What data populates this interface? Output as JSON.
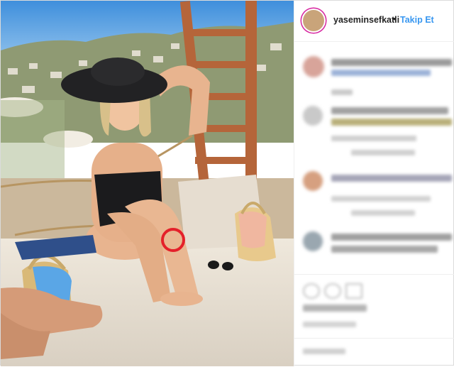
{
  "post": {
    "username": "yaseminsefkatli",
    "separator": "•",
    "follow_label": "Takip Et"
  },
  "colors": {
    "accent": "#3897f0",
    "highlight_ring": "#e4202a",
    "sky": "#5aa6e6"
  },
  "icons": [
    "heart-icon",
    "comment-icon",
    "share-icon",
    "circle-highlight"
  ]
}
